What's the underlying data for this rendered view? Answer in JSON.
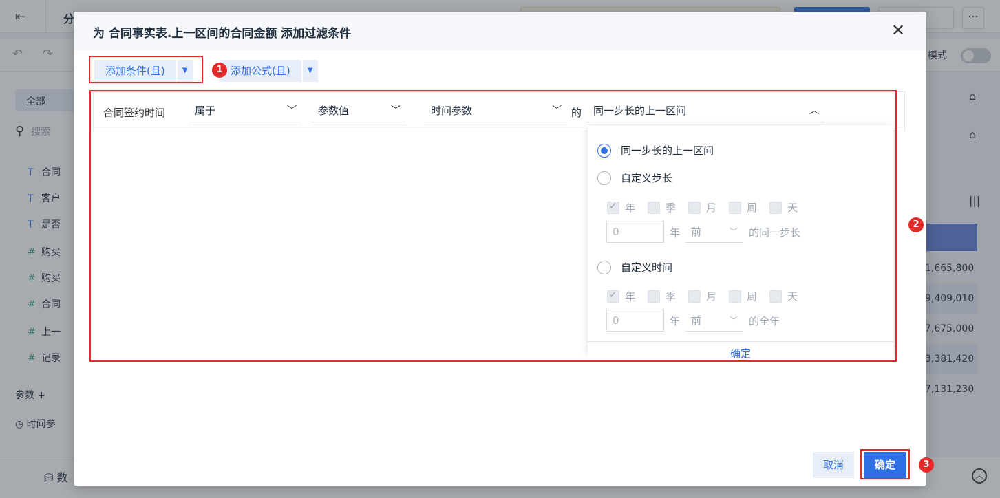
{
  "background": {
    "title_fragment": "分",
    "mode_label": "模式",
    "all_tab": "全部",
    "search_placeholder": "搜索",
    "fields": [
      {
        "icon": "T",
        "label": "合同"
      },
      {
        "icon": "T",
        "label": "客户"
      },
      {
        "icon": "T",
        "label": "是否"
      },
      {
        "icon": "#",
        "label": "购买"
      },
      {
        "icon": "#",
        "label": "购买"
      },
      {
        "icon": "#",
        "label": "合同"
      },
      {
        "icon": "#",
        "label": "上一"
      },
      {
        "icon": "#",
        "label": "记录"
      }
    ],
    "params_label": "参数",
    "time_param_label": "时间参",
    "table_values": [
      "1,665,800",
      "9,409,010",
      "7,675,000",
      "3,381,420",
      "7,131,230"
    ],
    "bottom_label": "数"
  },
  "dialog": {
    "title": "为 合同事实表.上一区间的合同金额 添加过滤条件",
    "add_condition": "添加条件(且)",
    "add_formula": "添加公式(且)",
    "condition": {
      "field": "合同签约时间",
      "operator": "属于",
      "value_type": "参数值",
      "param": "时间参数",
      "of": "的",
      "range": "同一步长的上一区间"
    },
    "dropdown": {
      "option_same_step": "同一步长的上一区间",
      "option_custom_step": "自定义步长",
      "option_custom_time": "自定义时间",
      "units": [
        "年",
        "季",
        "月",
        "周",
        "天"
      ],
      "step_input_value": "0",
      "step_unit": "年",
      "step_direction": "前",
      "step_suffix": "的同一步长",
      "time_input_value": "0",
      "time_unit": "年",
      "time_direction": "前",
      "time_suffix": "的全年",
      "confirm": "确定"
    },
    "cancel": "取消",
    "ok": "确定"
  },
  "annotations": {
    "badge1": "1",
    "badge2": "2",
    "badge3": "3",
    "color": "#e52a2a"
  },
  "colors": {
    "accent": "#2f6fe4",
    "annotation_red": "#e52a2a"
  }
}
